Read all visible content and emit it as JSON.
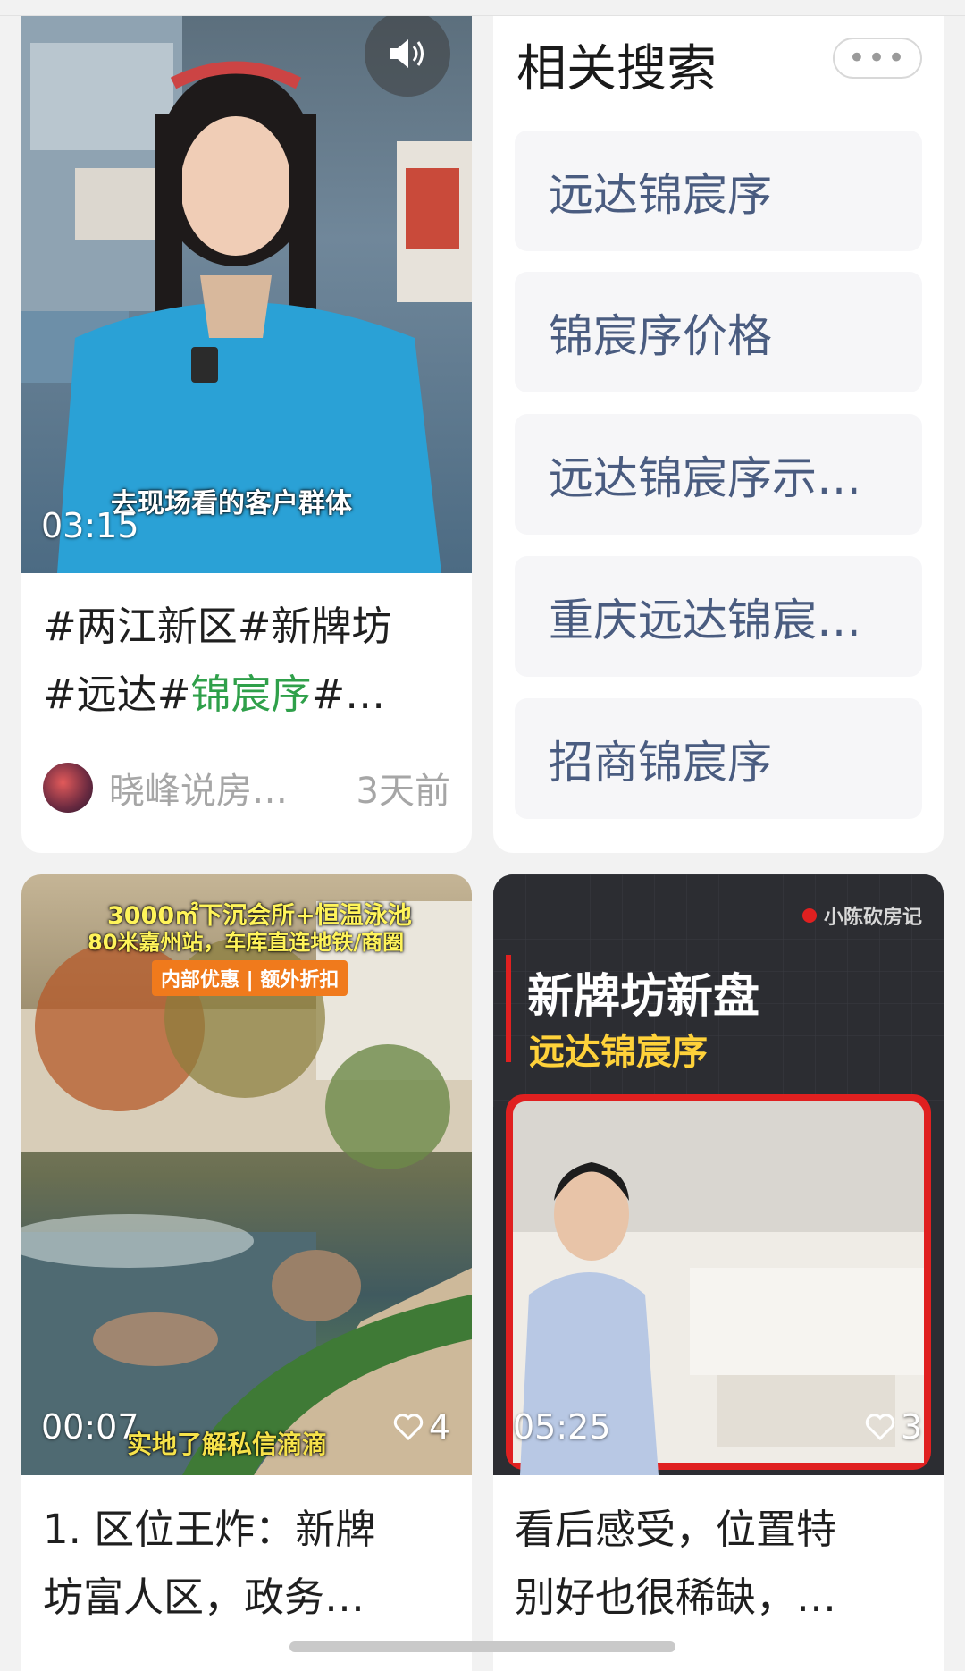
{
  "card1": {
    "duration": "03:15",
    "subtitle": "去现场看的客户群体",
    "title_parts": [
      "#两江新区#新牌坊",
      "#远达#",
      "锦宸序",
      "#…"
    ],
    "author": "晓峰说房…",
    "time": "3天前"
  },
  "related": {
    "title": "相关搜索",
    "more": "•••",
    "items": [
      "远达锦宸序",
      "锦宸序价格",
      "远达锦宸序示…",
      "重庆远达锦宸…",
      "招商锦宸序"
    ]
  },
  "card3": {
    "overlay_line1": "3000㎡下沉会所+恒温泳池",
    "overlay_line2": "80米嘉州站，车库直连地铁/商圈",
    "overlay_badge": "内部优惠 | 额外折扣",
    "subtitle": "实地了解私信滴滴",
    "duration": "00:07",
    "likes": "4",
    "title_line1": "1. 区位王炸：新牌",
    "title_line2": "坊富人区，政务…"
  },
  "card4": {
    "channel": "小陈砍房记",
    "overlay_title": "新牌坊新盘",
    "overlay_sub": "远达锦宸序",
    "duration": "05:25",
    "likes": "3",
    "title_line1": "看后感受，位置特",
    "title_line2": "别好也很稀缺，…"
  },
  "colors": {
    "highlight": "#2fa04a",
    "related_text": "#4a5c80",
    "accent_red": "#e02020"
  }
}
